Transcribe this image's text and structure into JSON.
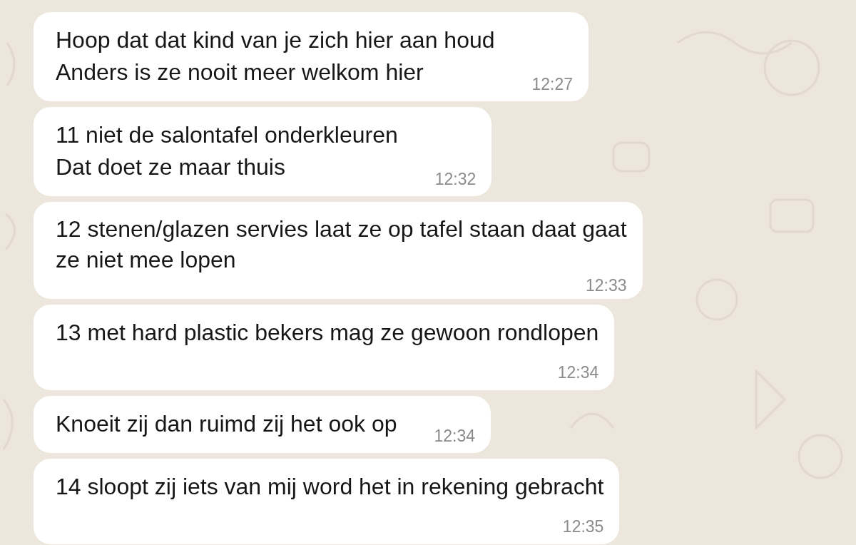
{
  "messages": [
    {
      "text": "Hoop dat dat kind van je zich hier aan houd\nAnders is ze nooit meer welkom hier",
      "time": "12:27",
      "kind": "beside"
    },
    {
      "text": "11 niet de salontafel onderkleuren\nDat doet ze maar thuis",
      "time": "12:32",
      "kind": "beside"
    },
    {
      "text": "12 stenen/glazen servies laat ze op tafel staan daat gaat\nze niet mee lopen",
      "time": "12:33",
      "kind": "under_last"
    },
    {
      "text": "13 met hard plastic bekers mag ze gewoon rondlopen",
      "time": "12:34",
      "kind": "below"
    },
    {
      "text": "Knoeit zij dan ruimd zij het ook op",
      "time": "12:34",
      "kind": "beside"
    },
    {
      "text": "14 sloopt zij iets van mij word het in rekening gebracht",
      "time": "12:35",
      "kind": "below"
    }
  ]
}
